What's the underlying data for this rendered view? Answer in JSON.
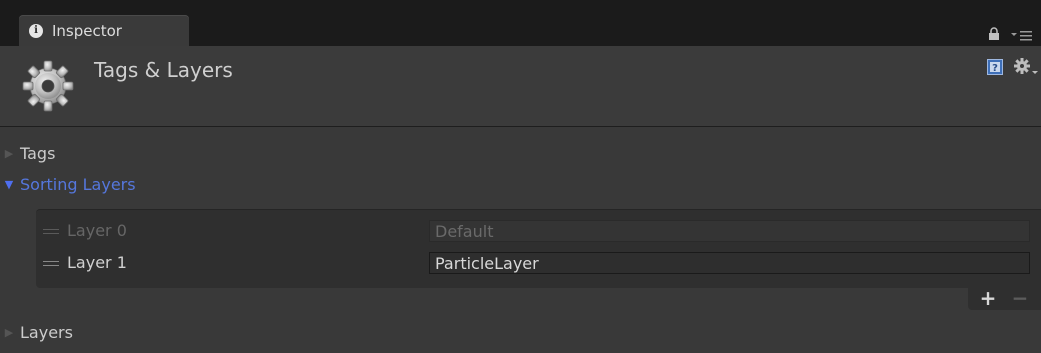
{
  "tab": {
    "label": "Inspector",
    "info_glyph": "i",
    "icons": [
      "info-icon",
      "lock-icon",
      "tab-menu-icon"
    ]
  },
  "header": {
    "title": "Tags & Layers",
    "icons": [
      "gear-icon",
      "help-icon",
      "settings-icon"
    ]
  },
  "sections": {
    "tags": {
      "label": "Tags",
      "expanded": false
    },
    "sorting_layers": {
      "label": "Sorting Layers",
      "expanded": true
    },
    "layers": {
      "label": "Layers",
      "expanded": false
    }
  },
  "sorting_layers": [
    {
      "name": "Layer 0",
      "value": "Default",
      "editable": false
    },
    {
      "name": "Layer 1",
      "value": "ParticleLayer",
      "editable": true
    }
  ],
  "list_footer": {
    "add_label": "+",
    "remove_label": "−"
  },
  "colors": {
    "accent": "#5577dd",
    "background": "#393939"
  }
}
